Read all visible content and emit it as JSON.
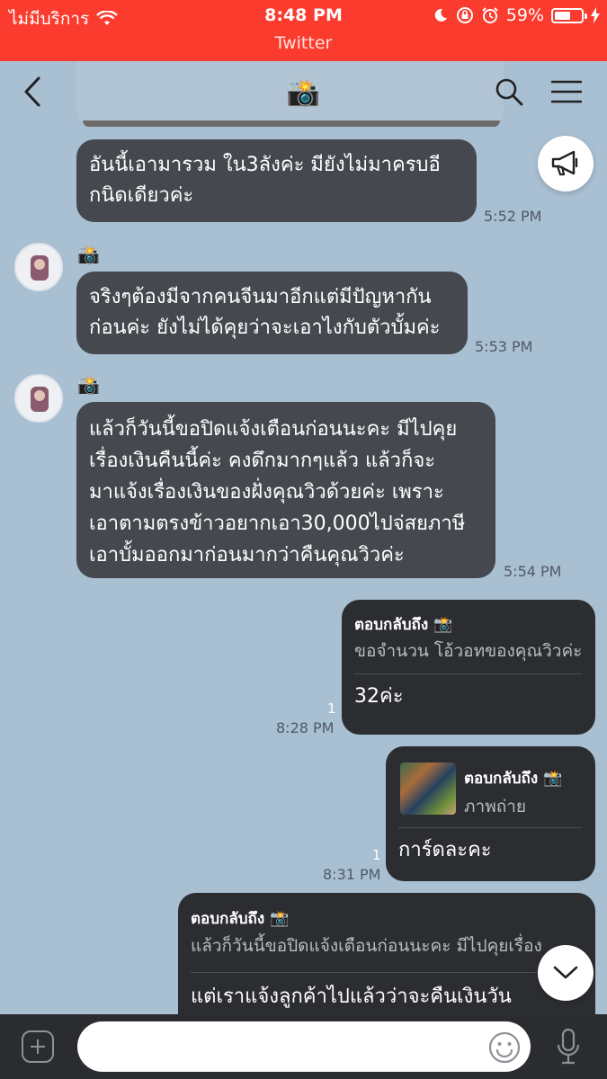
{
  "status_bar": {
    "carrier": "ไม่มีบริการ",
    "time": "8:48 PM",
    "battery": "59%",
    "battery_level": 0.59,
    "app_banner": "Twitter"
  },
  "header": {
    "title": "📸",
    "back_icon": "chevron-left-icon",
    "search_icon": "search-icon",
    "menu_icon": "menu-icon"
  },
  "messages": [
    {
      "direction": "in",
      "text": "อันนี้เอามารวม ใน3ลังค่ะ มียังไม่มาครบอี\nกนิดเดียวค่ะ",
      "time": "5:52 PM"
    },
    {
      "direction": "in",
      "sender": "📸",
      "text": "จริงๆต้องมีจากคนจีนมาอีกแต่มีปัญหากัน\nก่อนค่ะ ยังไม่ได้คุยว่าจะเอาไงกับตัวบั้มค่ะ",
      "time": "5:53 PM"
    },
    {
      "direction": "in",
      "sender": "📸",
      "text": "แล้วก็วันนี้ขอปิดแจ้งเตือนก่อนนะคะ มีไปคุย\nเรื่องเงินคืนนี้ค่ะ คงดึกมากๆแล้ว แล้วก็จะ\nมาแจ้งเรื่องเงินของฝั่งคุณวิวด้วยค่ะ เพราะ\nเอาตามตรงข้าวอยากเอา30,000ไปจ่สยภาษี\nเอาบั้มออกมาก่อนมากว่าคืนคุณวิวค่ะ",
      "time": "5:54 PM"
    },
    {
      "direction": "out",
      "reply_label": "ตอบกลับถึง 📸",
      "reply_text": "ขอจำนวน โอ้วอทของคุณวิวค่ะ",
      "text": "32ค่ะ",
      "read": "1",
      "time": "8:28 PM"
    },
    {
      "direction": "out",
      "reply_label": "ตอบกลับถึง 📸",
      "reply_text": "ภาพถ่าย",
      "text": "การ์ดละคะ",
      "read": "1",
      "time": "8:31 PM"
    },
    {
      "direction": "out",
      "reply_label": "ตอบกลับถึง 📸",
      "reply_text": "แล้วก็วันนี้ขอปิดแจ้งเตือนก่อนนะคะ มีไปคุยเรื่อง",
      "text": "แต่เราแจ้งลูกค้าไปแล้วว่าจะคืนเงินวัน"
    }
  ],
  "floating": {
    "announce_icon": "megaphone-icon",
    "scroll_down_icon": "chevron-down-icon"
  },
  "input_bar": {
    "plus_icon": "plus-icon",
    "placeholder": "",
    "emoji_icon": "emoji-icon",
    "mic_icon": "microphone-icon"
  }
}
